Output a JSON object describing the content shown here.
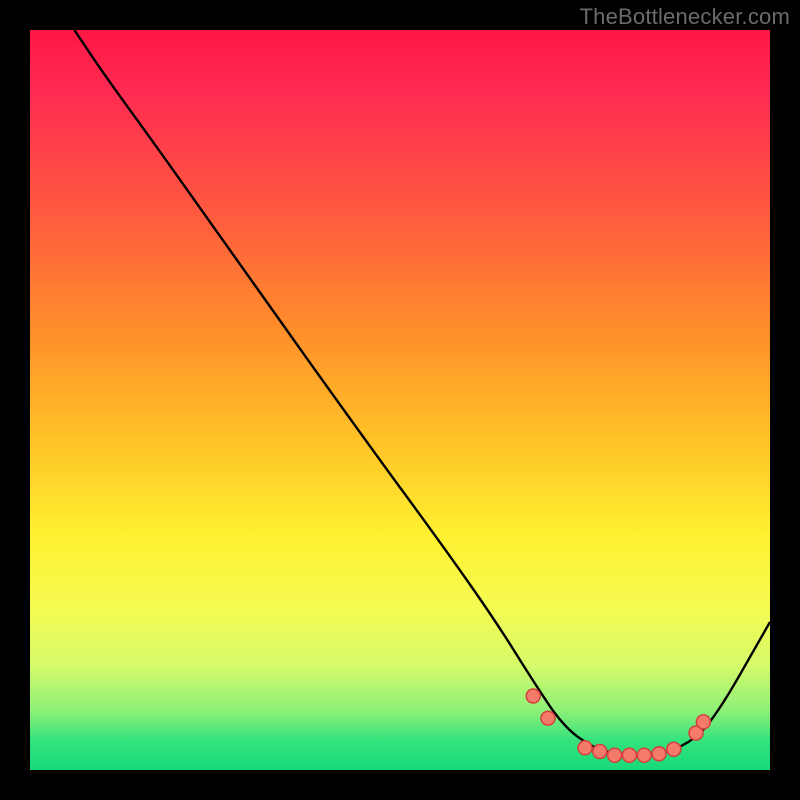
{
  "source_label": "TheBottlenecker.com",
  "colors": {
    "background": "#000000",
    "curve": "#000000",
    "marker_fill": "#f47a6a",
    "marker_outline": "#d63f3f",
    "gradient_top": "#ff1744",
    "gradient_bottom": "#17d97a"
  },
  "chart_data": {
    "type": "line",
    "xlabel": "",
    "ylabel": "",
    "title": "",
    "xlim": [
      0,
      100
    ],
    "ylim": [
      0,
      100
    ],
    "grid": false,
    "legend": false,
    "series": [
      {
        "name": "curve",
        "x": [
          6,
          10,
          18,
          30,
          45,
          56,
          63,
          68,
          72,
          76,
          80,
          84,
          88,
          92,
          100
        ],
        "y": [
          100,
          94,
          83,
          66,
          45,
          30,
          20,
          12,
          6,
          3,
          2,
          2,
          3,
          6,
          20
        ]
      }
    ],
    "markers": {
      "name": "highlight-points",
      "x": [
        68,
        70,
        75,
        77,
        79,
        81,
        83,
        85,
        87,
        90,
        91
      ],
      "y": [
        10,
        7,
        3,
        2.5,
        2,
        2,
        2,
        2.2,
        2.8,
        5,
        6.5
      ]
    }
  }
}
